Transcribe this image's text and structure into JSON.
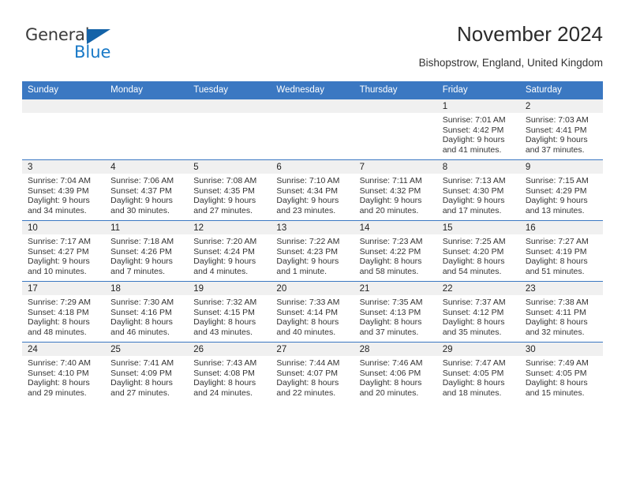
{
  "brand": {
    "name_part1": "General",
    "name_part2": "Blue",
    "triangle_color": "#1463a8",
    "blue_color": "#1879c7"
  },
  "header": {
    "title": "November 2024",
    "subtitle": "Bishopstrow, England, United Kingdom"
  },
  "theme": {
    "header_row_bg": "#3b78c2",
    "header_row_text": "#ffffff",
    "daynum_band_bg": "#f0f0f0",
    "grid_line": "#3b78c2",
    "body_text": "#333333"
  },
  "weekdays": [
    "Sunday",
    "Monday",
    "Tuesday",
    "Wednesday",
    "Thursday",
    "Friday",
    "Saturday"
  ],
  "labels": {
    "sunrise_prefix": "Sunrise:",
    "sunset_prefix": "Sunset:",
    "daylight_prefix": "Daylight:"
  },
  "weeks": [
    [
      {
        "day": ""
      },
      {
        "day": ""
      },
      {
        "day": ""
      },
      {
        "day": ""
      },
      {
        "day": ""
      },
      {
        "day": "1",
        "sunrise": "Sunrise: 7:01 AM",
        "sunset": "Sunset: 4:42 PM",
        "daylight1": "Daylight: 9 hours",
        "daylight2": "and 41 minutes."
      },
      {
        "day": "2",
        "sunrise": "Sunrise: 7:03 AM",
        "sunset": "Sunset: 4:41 PM",
        "daylight1": "Daylight: 9 hours",
        "daylight2": "and 37 minutes."
      }
    ],
    [
      {
        "day": "3",
        "sunrise": "Sunrise: 7:04 AM",
        "sunset": "Sunset: 4:39 PM",
        "daylight1": "Daylight: 9 hours",
        "daylight2": "and 34 minutes."
      },
      {
        "day": "4",
        "sunrise": "Sunrise: 7:06 AM",
        "sunset": "Sunset: 4:37 PM",
        "daylight1": "Daylight: 9 hours",
        "daylight2": "and 30 minutes."
      },
      {
        "day": "5",
        "sunrise": "Sunrise: 7:08 AM",
        "sunset": "Sunset: 4:35 PM",
        "daylight1": "Daylight: 9 hours",
        "daylight2": "and 27 minutes."
      },
      {
        "day": "6",
        "sunrise": "Sunrise: 7:10 AM",
        "sunset": "Sunset: 4:34 PM",
        "daylight1": "Daylight: 9 hours",
        "daylight2": "and 23 minutes."
      },
      {
        "day": "7",
        "sunrise": "Sunrise: 7:11 AM",
        "sunset": "Sunset: 4:32 PM",
        "daylight1": "Daylight: 9 hours",
        "daylight2": "and 20 minutes."
      },
      {
        "day": "8",
        "sunrise": "Sunrise: 7:13 AM",
        "sunset": "Sunset: 4:30 PM",
        "daylight1": "Daylight: 9 hours",
        "daylight2": "and 17 minutes."
      },
      {
        "day": "9",
        "sunrise": "Sunrise: 7:15 AM",
        "sunset": "Sunset: 4:29 PM",
        "daylight1": "Daylight: 9 hours",
        "daylight2": "and 13 minutes."
      }
    ],
    [
      {
        "day": "10",
        "sunrise": "Sunrise: 7:17 AM",
        "sunset": "Sunset: 4:27 PM",
        "daylight1": "Daylight: 9 hours",
        "daylight2": "and 10 minutes."
      },
      {
        "day": "11",
        "sunrise": "Sunrise: 7:18 AM",
        "sunset": "Sunset: 4:26 PM",
        "daylight1": "Daylight: 9 hours",
        "daylight2": "and 7 minutes."
      },
      {
        "day": "12",
        "sunrise": "Sunrise: 7:20 AM",
        "sunset": "Sunset: 4:24 PM",
        "daylight1": "Daylight: 9 hours",
        "daylight2": "and 4 minutes."
      },
      {
        "day": "13",
        "sunrise": "Sunrise: 7:22 AM",
        "sunset": "Sunset: 4:23 PM",
        "daylight1": "Daylight: 9 hours",
        "daylight2": "and 1 minute."
      },
      {
        "day": "14",
        "sunrise": "Sunrise: 7:23 AM",
        "sunset": "Sunset: 4:22 PM",
        "daylight1": "Daylight: 8 hours",
        "daylight2": "and 58 minutes."
      },
      {
        "day": "15",
        "sunrise": "Sunrise: 7:25 AM",
        "sunset": "Sunset: 4:20 PM",
        "daylight1": "Daylight: 8 hours",
        "daylight2": "and 54 minutes."
      },
      {
        "day": "16",
        "sunrise": "Sunrise: 7:27 AM",
        "sunset": "Sunset: 4:19 PM",
        "daylight1": "Daylight: 8 hours",
        "daylight2": "and 51 minutes."
      }
    ],
    [
      {
        "day": "17",
        "sunrise": "Sunrise: 7:29 AM",
        "sunset": "Sunset: 4:18 PM",
        "daylight1": "Daylight: 8 hours",
        "daylight2": "and 48 minutes."
      },
      {
        "day": "18",
        "sunrise": "Sunrise: 7:30 AM",
        "sunset": "Sunset: 4:16 PM",
        "daylight1": "Daylight: 8 hours",
        "daylight2": "and 46 minutes."
      },
      {
        "day": "19",
        "sunrise": "Sunrise: 7:32 AM",
        "sunset": "Sunset: 4:15 PM",
        "daylight1": "Daylight: 8 hours",
        "daylight2": "and 43 minutes."
      },
      {
        "day": "20",
        "sunrise": "Sunrise: 7:33 AM",
        "sunset": "Sunset: 4:14 PM",
        "daylight1": "Daylight: 8 hours",
        "daylight2": "and 40 minutes."
      },
      {
        "day": "21",
        "sunrise": "Sunrise: 7:35 AM",
        "sunset": "Sunset: 4:13 PM",
        "daylight1": "Daylight: 8 hours",
        "daylight2": "and 37 minutes."
      },
      {
        "day": "22",
        "sunrise": "Sunrise: 7:37 AM",
        "sunset": "Sunset: 4:12 PM",
        "daylight1": "Daylight: 8 hours",
        "daylight2": "and 35 minutes."
      },
      {
        "day": "23",
        "sunrise": "Sunrise: 7:38 AM",
        "sunset": "Sunset: 4:11 PM",
        "daylight1": "Daylight: 8 hours",
        "daylight2": "and 32 minutes."
      }
    ],
    [
      {
        "day": "24",
        "sunrise": "Sunrise: 7:40 AM",
        "sunset": "Sunset: 4:10 PM",
        "daylight1": "Daylight: 8 hours",
        "daylight2": "and 29 minutes."
      },
      {
        "day": "25",
        "sunrise": "Sunrise: 7:41 AM",
        "sunset": "Sunset: 4:09 PM",
        "daylight1": "Daylight: 8 hours",
        "daylight2": "and 27 minutes."
      },
      {
        "day": "26",
        "sunrise": "Sunrise: 7:43 AM",
        "sunset": "Sunset: 4:08 PM",
        "daylight1": "Daylight: 8 hours",
        "daylight2": "and 24 minutes."
      },
      {
        "day": "27",
        "sunrise": "Sunrise: 7:44 AM",
        "sunset": "Sunset: 4:07 PM",
        "daylight1": "Daylight: 8 hours",
        "daylight2": "and 22 minutes."
      },
      {
        "day": "28",
        "sunrise": "Sunrise: 7:46 AM",
        "sunset": "Sunset: 4:06 PM",
        "daylight1": "Daylight: 8 hours",
        "daylight2": "and 20 minutes."
      },
      {
        "day": "29",
        "sunrise": "Sunrise: 7:47 AM",
        "sunset": "Sunset: 4:05 PM",
        "daylight1": "Daylight: 8 hours",
        "daylight2": "and 18 minutes."
      },
      {
        "day": "30",
        "sunrise": "Sunrise: 7:49 AM",
        "sunset": "Sunset: 4:05 PM",
        "daylight1": "Daylight: 8 hours",
        "daylight2": "and 15 minutes."
      }
    ]
  ]
}
